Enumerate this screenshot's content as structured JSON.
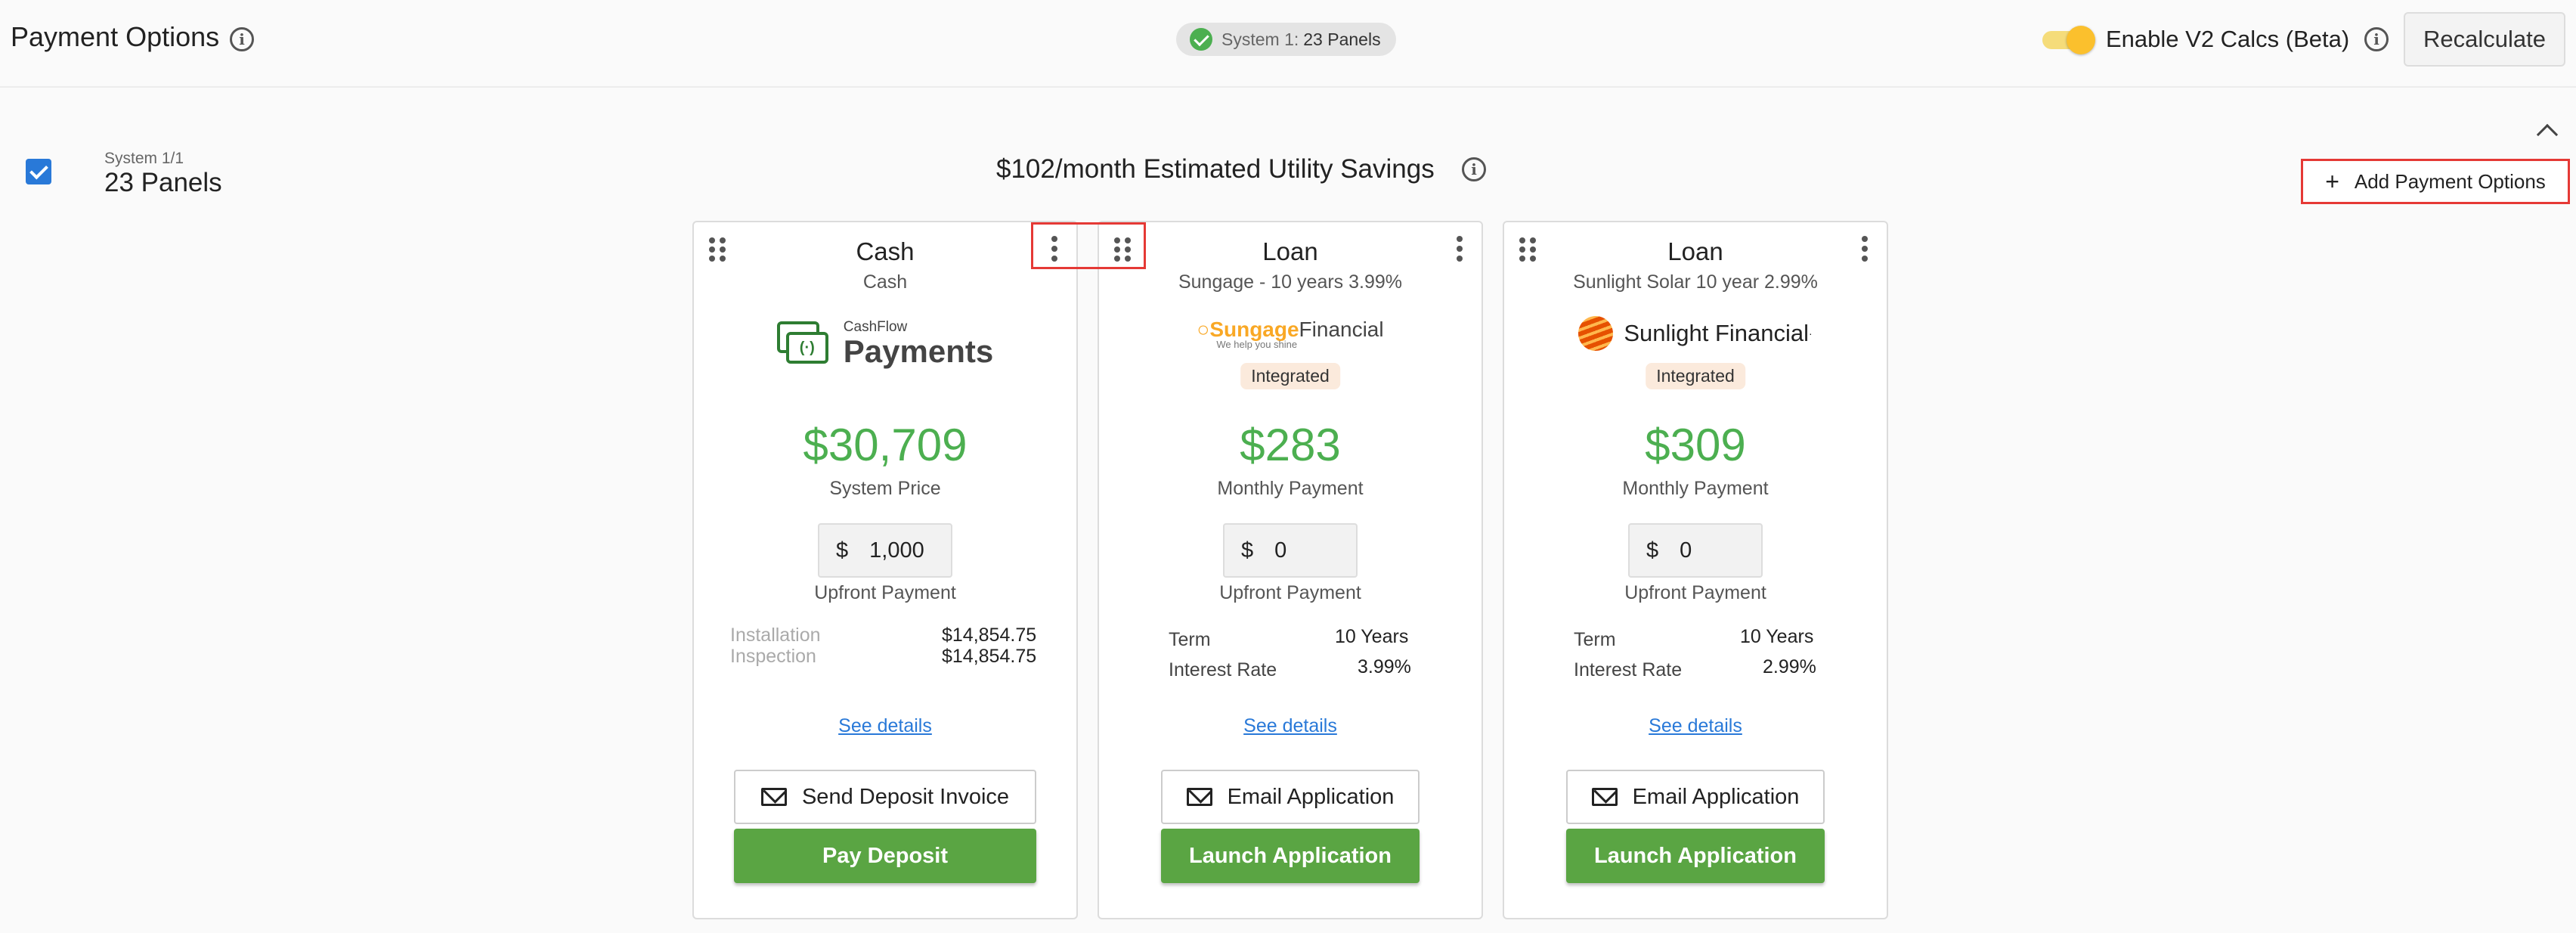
{
  "header": {
    "title": "Payment Options",
    "system_chip": {
      "prefix": "System 1:",
      "value": "23 Panels"
    },
    "toggle_label": "Enable V2 Calcs (Beta)",
    "recalculate_label": "Recalculate"
  },
  "system": {
    "label_small": "System 1/1",
    "label_big": "23 Panels",
    "savings": "$102/month Estimated Utility Savings",
    "add_button": "Add Payment Options"
  },
  "cards": [
    {
      "title": "Cash",
      "subtitle": "Cash",
      "logo": {
        "small": "CashFlow",
        "big": "Payments",
        "icon": "cash-icon"
      },
      "amount": "$30,709",
      "amount_label": "System Price",
      "currency": "$",
      "upfront_value": "1,000",
      "upfront_label": "Upfront Payment",
      "details": [
        {
          "label": "Installation",
          "value": "$14,854.75"
        },
        {
          "label": "Inspection",
          "value": "$14,854.75"
        }
      ],
      "see_details": "See details",
      "secondary_btn": "Send Deposit Invoice",
      "primary_btn": "Pay Deposit"
    },
    {
      "title": "Loan",
      "subtitle": "Sungage - 10 years 3.99%",
      "logo": {
        "brand": "Sungage",
        "brand2": "Financial",
        "tagline": "We help you shine"
      },
      "badge": "Integrated",
      "amount": "$283",
      "amount_label": "Monthly Payment",
      "currency": "$",
      "upfront_value": "0",
      "upfront_label": "Upfront Payment",
      "details": [
        {
          "label": "Term",
          "value": "10 Years"
        },
        {
          "label": "Interest Rate",
          "value": "3.99%"
        }
      ],
      "see_details": "See details",
      "secondary_btn": "Email Application",
      "primary_btn": "Launch Application"
    },
    {
      "title": "Loan",
      "subtitle": "Sunlight Solar 10 year 2.99%",
      "logo": {
        "brand": "Sunlight Financial",
        "mark": "·"
      },
      "badge": "Integrated",
      "amount": "$309",
      "amount_label": "Monthly Payment",
      "currency": "$",
      "upfront_value": "0",
      "upfront_label": "Upfront Payment",
      "details": [
        {
          "label": "Term",
          "value": "10 Years"
        },
        {
          "label": "Interest Rate",
          "value": "2.99%"
        }
      ],
      "see_details": "See details",
      "secondary_btn": "Email Application",
      "primary_btn": "Launch Application"
    }
  ],
  "colors": {
    "accent_green": "#4caf50",
    "button_green": "#5aa543",
    "link_blue": "#2979d8",
    "highlight_red": "#e53935",
    "toggle_yellow": "#fbc02d"
  }
}
